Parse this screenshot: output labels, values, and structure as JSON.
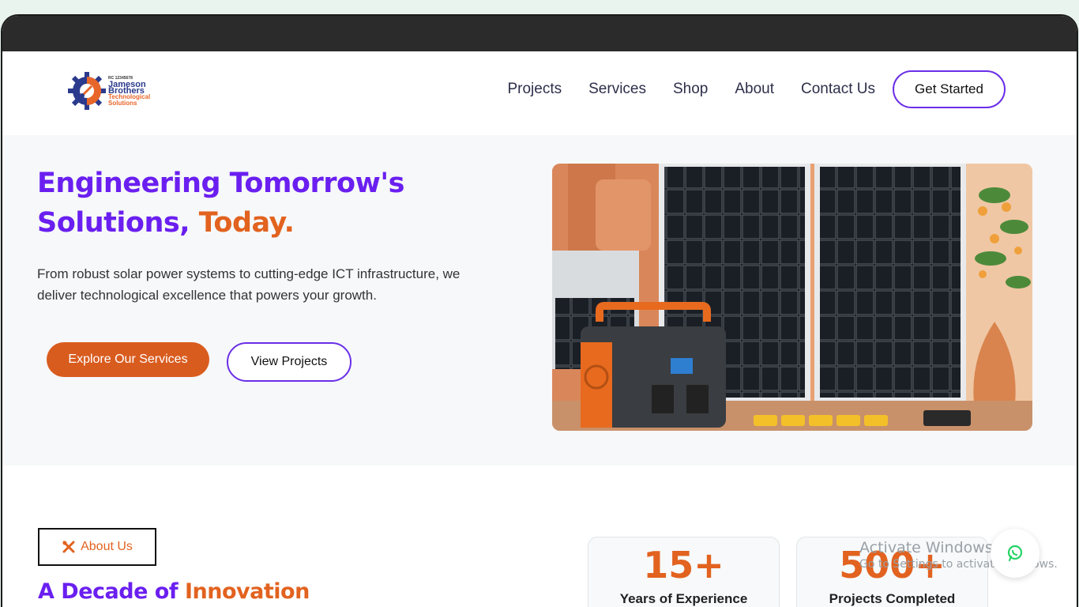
{
  "nav": {
    "logo": {
      "small": "RC 12345678",
      "line1": "Jameson",
      "line2": "Brothers",
      "line3": "Technological",
      "line4": "Solutions"
    },
    "links": [
      "Projects",
      "Services",
      "Shop",
      "About",
      "Contact Us"
    ],
    "cta": "Get Started"
  },
  "hero": {
    "title_line1": "Engineering Tomorrow's",
    "title_line2": "Solutions,",
    "title_accent": "Today.",
    "description": "From robust solar power systems to cutting-edge ICT infrastructure, we deliver technological excellence that powers your growth.",
    "primary_button": "Explore Our Services",
    "secondary_button": "View Projects"
  },
  "about": {
    "badge": "About Us",
    "title": "A Decade of",
    "title_accent": "Innovation"
  },
  "stats": [
    {
      "value": "15+",
      "label": "Years of Experience"
    },
    {
      "value": "500+",
      "label": "Projects Completed"
    }
  ],
  "os_watermark": {
    "line1": "Activate Windows",
    "line2": "Go to Settings to activate Windows."
  },
  "colors": {
    "purple": "#6a1ff0",
    "orange": "#e2621f",
    "dark_bar": "#2b2b2b"
  }
}
